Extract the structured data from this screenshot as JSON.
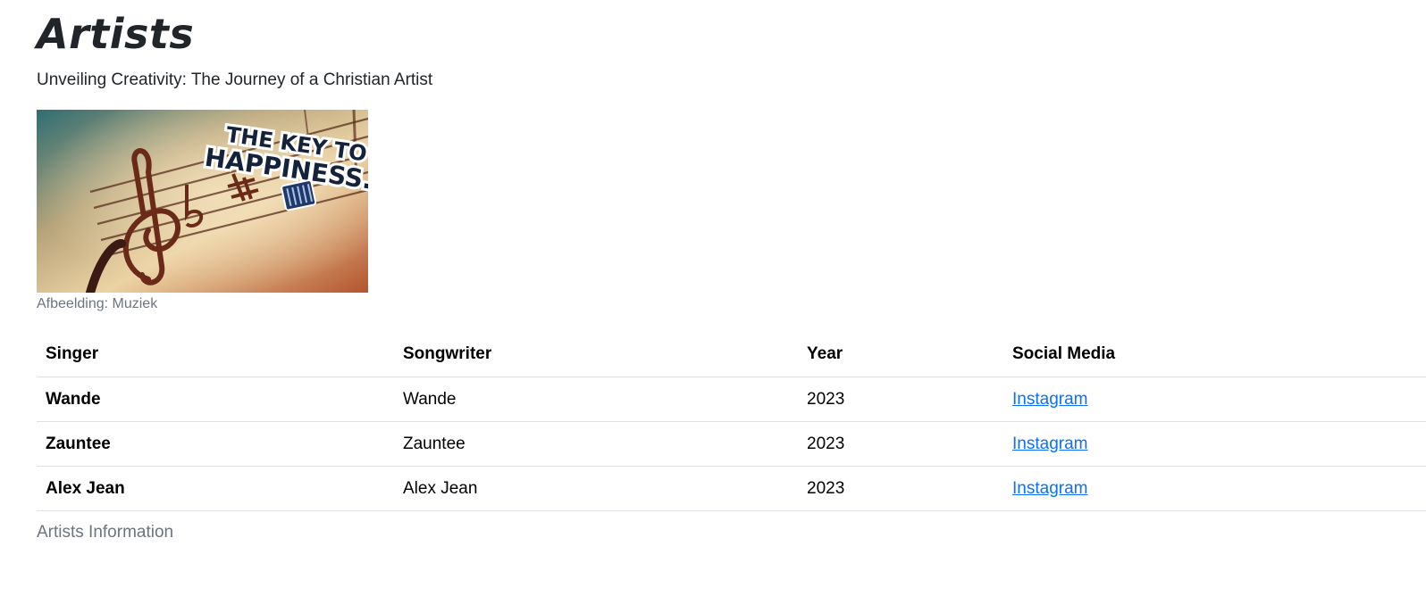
{
  "page": {
    "title": "Artists",
    "subtitle": "Unveiling Creativity: The Journey of a Christian Artist"
  },
  "figure": {
    "image_text_line1": "THE KEY TO",
    "image_text_line2": "HAPPINESS.",
    "caption": "Afbeelding: Muziek"
  },
  "table": {
    "headers": [
      "Singer",
      "Songwriter",
      "Year",
      "Social Media"
    ],
    "rows": [
      {
        "singer": "Wande",
        "songwriter": "Wande",
        "year": "2023",
        "social": "Instagram"
      },
      {
        "singer": "Zauntee",
        "songwriter": "Zauntee",
        "year": "2023",
        "social": "Instagram"
      },
      {
        "singer": "Alex Jean",
        "songwriter": "Alex Jean",
        "year": "2023",
        "social": "Instagram"
      }
    ],
    "caption": "Artists Information"
  },
  "colors": {
    "text": "#212529",
    "muted": "#6c757d",
    "link": "#0d6efd",
    "border": "#dee2e6"
  }
}
